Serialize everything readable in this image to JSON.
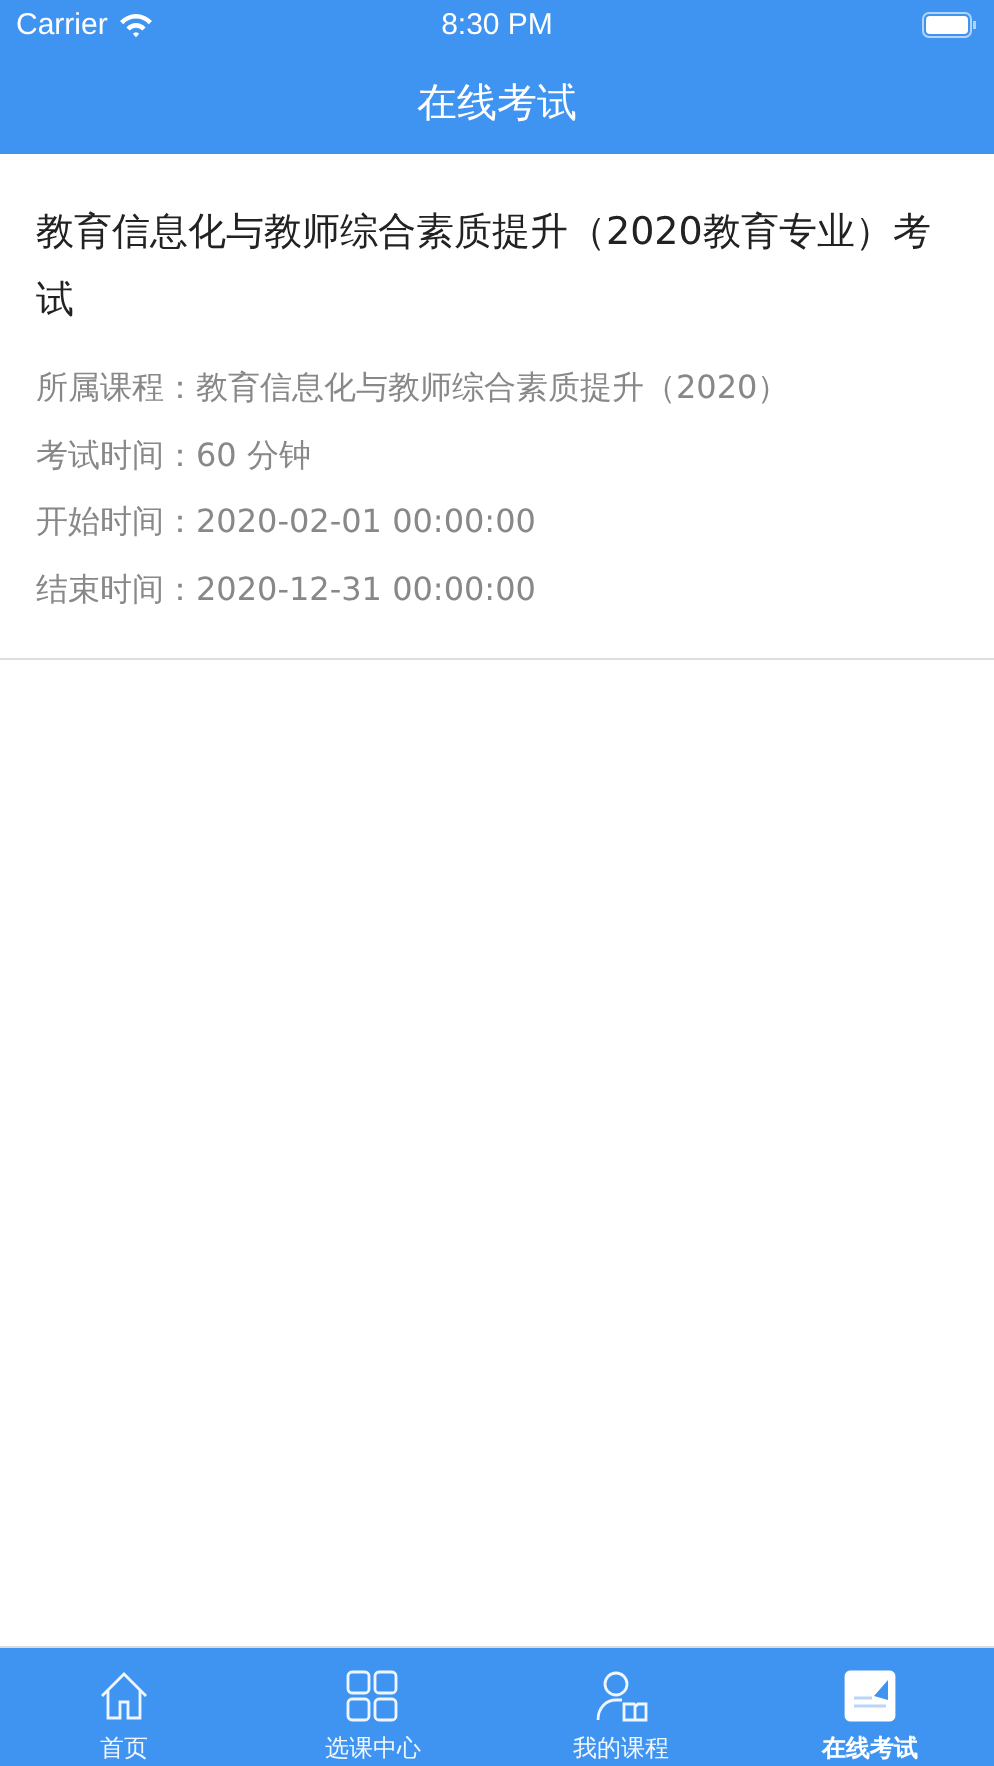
{
  "status_bar": {
    "carrier": "Carrier",
    "time": "8:30 PM"
  },
  "nav": {
    "title": "在线考试"
  },
  "exam": {
    "title": "教育信息化与教师综合素质提升（2020教育专业）考试",
    "details": [
      {
        "label": "所属课程：",
        "value": "教育信息化与教师综合素质提升（2020）"
      },
      {
        "label": "考试时间：",
        "value": "60 分钟"
      },
      {
        "label": "开始时间：",
        "value": "2020-02-01 00:00:00"
      },
      {
        "label": "结束时间：",
        "value": "2020-12-31 00:00:00"
      }
    ]
  },
  "tabs": [
    {
      "label": "首页",
      "kind": "home",
      "selected": false
    },
    {
      "label": "选课中心",
      "kind": "grid",
      "selected": false
    },
    {
      "label": "我的课程",
      "kind": "person",
      "selected": false
    },
    {
      "label": "在线考试",
      "kind": "exam",
      "selected": true
    }
  ]
}
